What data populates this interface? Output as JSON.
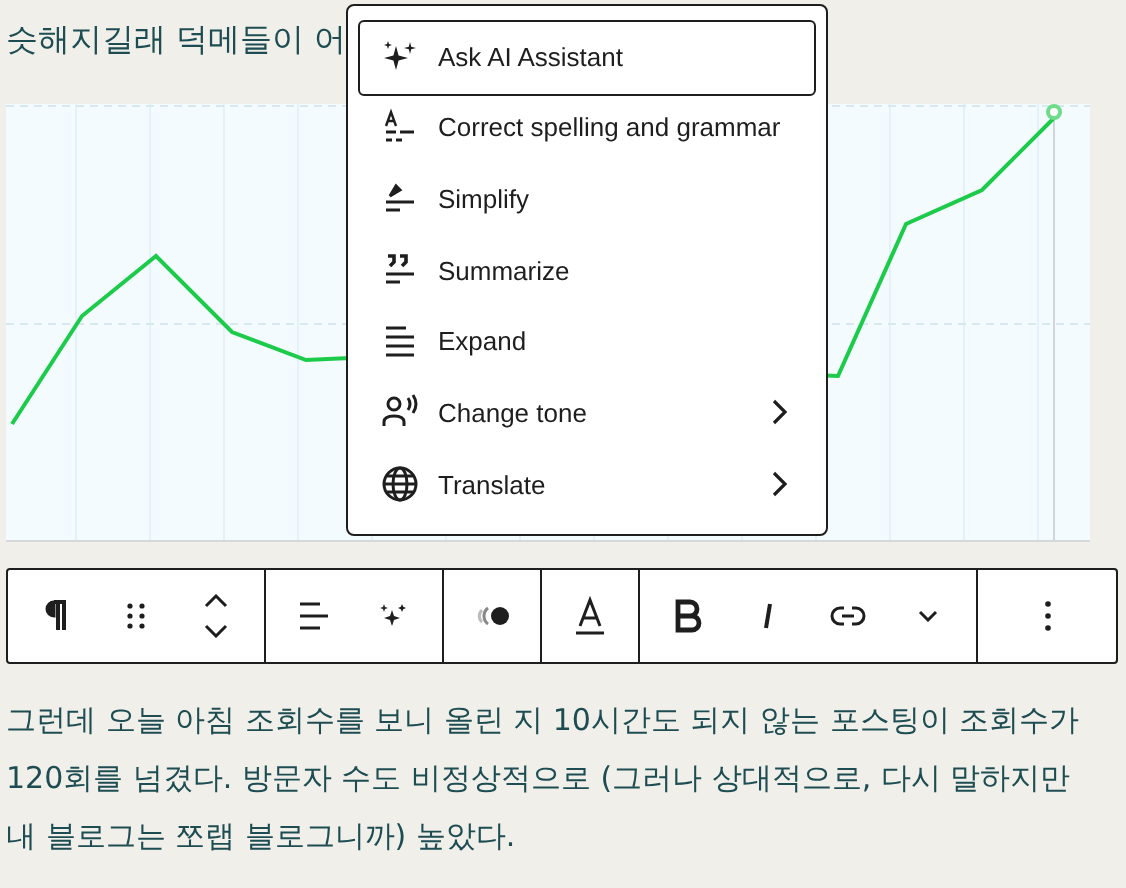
{
  "heading": "슷해지길래 덕메들이 어",
  "menu": {
    "items": [
      {
        "kind": "action",
        "label": "Ask AI Assistant",
        "selected": true
      },
      {
        "kind": "action",
        "label": "Correct spelling and grammar",
        "selected": false
      },
      {
        "kind": "action",
        "label": "Simplify",
        "selected": false
      },
      {
        "kind": "action",
        "label": "Summarize",
        "selected": false
      },
      {
        "kind": "action",
        "label": "Expand",
        "selected": false
      },
      {
        "kind": "submenu",
        "label": "Change tone",
        "selected": false
      },
      {
        "kind": "submenu",
        "label": "Translate",
        "selected": false
      }
    ]
  },
  "paragraph": "그런데 오늘 아침 조회수를 보니 올린 지 10시간도 되지 않는 포스팅이 조회수가 120회를 넘겼다. 방문자 수도 비정상적으로 (그러나 상대적으로, 다시 말하지만 내 블로그는 쪼랩 블로그니까) 높았다."
}
